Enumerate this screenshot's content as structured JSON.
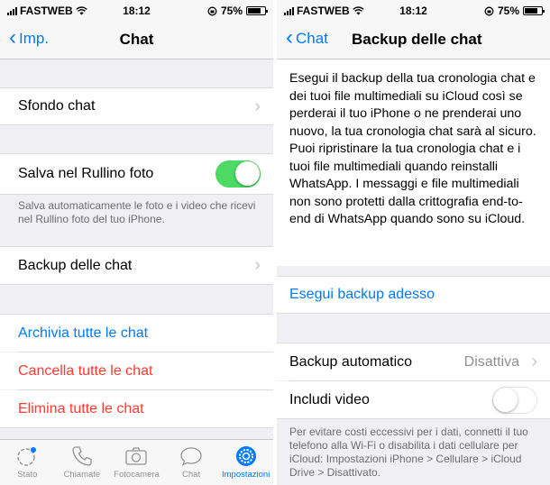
{
  "status_left": {
    "carrier": "FASTWEB",
    "time": "18:12",
    "battery": "75%"
  },
  "status_right": {
    "carrier": "FASTWEB",
    "time": "18:12",
    "battery": "75%"
  },
  "left": {
    "back_label": "Imp.",
    "title": "Chat",
    "wallpaper_label": "Sfondo chat",
    "save_photos_label": "Salva nel Rullino foto",
    "save_photos_on": true,
    "save_photos_footnote": "Salva automaticamente le foto e i video che ricevi nel Rullino foto del tuo iPhone.",
    "backup_label": "Backup delle chat",
    "archive_all": "Archivia tutte le chat",
    "clear_all": "Cancella tutte le chat",
    "delete_all": "Elimina tutte le chat"
  },
  "tabs": [
    {
      "label": "Stato",
      "icon": "status-icon",
      "active": false
    },
    {
      "label": "Chiamate",
      "icon": "phone-icon",
      "active": false
    },
    {
      "label": "Fotocamera",
      "icon": "camera-icon",
      "active": false
    },
    {
      "label": "Chat",
      "icon": "chat-bubble-icon",
      "active": false
    },
    {
      "label": "Impostazioni",
      "icon": "gear-icon",
      "active": true
    }
  ],
  "right": {
    "back_label": "Chat",
    "title": "Backup delle chat",
    "description": "Esegui il backup della tua cronologia chat e dei tuoi file multimediali su iCloud così se perderai il tuo iPhone o ne prenderai uno nuovo, la tua cronologia chat sarà al sicuro. Puoi ripristinare la tua cronologia chat e i tuoi file multimediali quando reinstalli WhatsApp. I messaggi e file multimediali non sono protetti dalla crittografia end-to-end di WhatsApp quando sono su iCloud.",
    "backup_now": "Esegui backup adesso",
    "auto_backup_label": "Backup automatico",
    "auto_backup_value": "Disattiva",
    "include_video_label": "Includi video",
    "include_video_on": false,
    "footnote": "Per evitare costi eccessivi per i dati, connetti il tuo telefono alla Wi-Fi o disabilita i dati cellulare per iCloud: Impostazioni iPhone > Cellulare > iCloud Drive > Disattivato."
  },
  "colors": {
    "accent": "#007aff",
    "destructive": "#ff3b30",
    "toggle_on": "#4cd964"
  }
}
